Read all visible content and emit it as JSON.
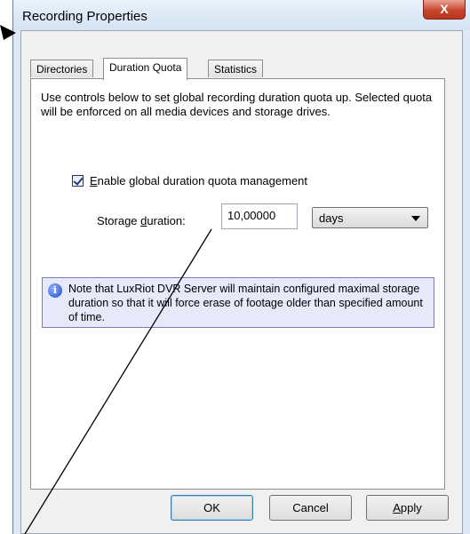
{
  "window": {
    "title": "Recording Properties",
    "close_glyph": "X"
  },
  "tabs": [
    {
      "label": "Directories",
      "active": false
    },
    {
      "label": "Duration Quota",
      "active": true
    },
    {
      "label": "Statistics",
      "active": false
    }
  ],
  "panel": {
    "description": "Use controls below to set global recording duration quota up. Selected quota will be enforced on all media devices and storage drives.",
    "checkbox": {
      "label_first": "E",
      "label_rest": "nable global duration quota management",
      "checked": true
    },
    "duration": {
      "label_pre": "Storage ",
      "label_u": "d",
      "label_post": "uration:",
      "value": "10,00000",
      "unit": "days"
    },
    "note": {
      "icon": "info-icon",
      "text": "Note that LuxRiot DVR Server will maintain configured maximal storage duration so that it will force erase of footage older than specified amount of time."
    }
  },
  "buttons": {
    "ok": "OK",
    "cancel": "Cancel",
    "apply_first": "A",
    "apply_rest": "pply"
  },
  "colors": {
    "frame": "#dfe9f5",
    "close_button": "#c8462e",
    "note_background": "#e8e8fb",
    "default_button_border": "#3c7fb1"
  }
}
